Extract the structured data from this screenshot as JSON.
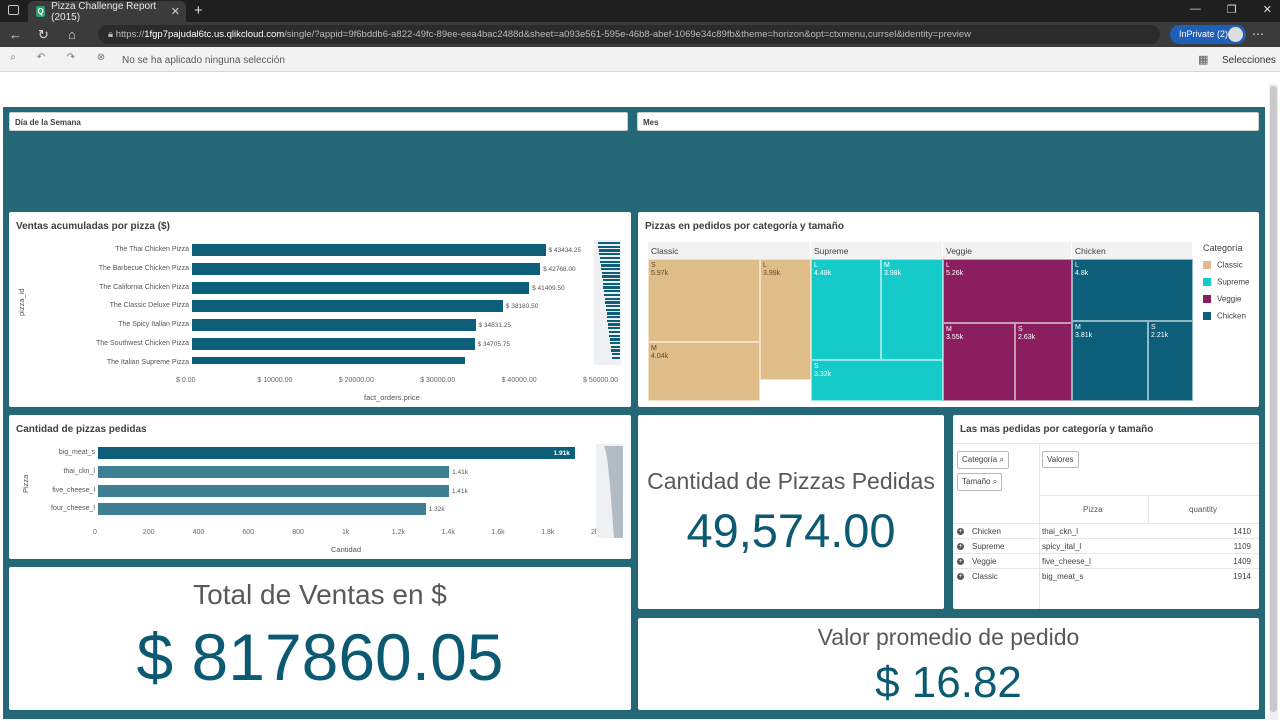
{
  "browser": {
    "tab_title": "Pizza Challenge Report (2015)",
    "url_prefix": "https://",
    "url_host": "1fgp7pajudal6tc.us.qlikcloud.com",
    "url_path": "/single/?appid=9f6bddb6-a822-49fc-89ee-eea4bac2488d&sheet=a093e561-595e-46b8-abef-1069e34c89fb&theme=horizon&opt=ctxmenu,currsel&identity=preview",
    "inprivate_label": "InPrivate (2)"
  },
  "toolbar": {
    "no_selection": "No se ha aplicado ninguna selección",
    "selections_label": "Selecciones"
  },
  "filters": {
    "day_of_week": "Día de la Semana",
    "month": "Mes"
  },
  "sales_chart": {
    "title": "Ventas acumuladas por pizza ($)",
    "xlabel": "fact_orders.price",
    "ylabel": "pizza_id"
  },
  "treemap": {
    "title": "Pizzas en pedidos por categoría y tamaño",
    "legend_title": "Categoría",
    "legend": [
      {
        "label": "Classic",
        "color": "#dfbd88"
      },
      {
        "label": "Supreme",
        "color": "#14cbc9"
      },
      {
        "label": "Veggie",
        "color": "#8b1e5e"
      },
      {
        "label": "Chicken",
        "color": "#0d5f79"
      }
    ],
    "groups": [
      {
        "name": "Classic",
        "cells": [
          {
            "size": "S",
            "value": "5.97k"
          },
          {
            "size": "L",
            "value": "3.99k"
          },
          {
            "size": "M",
            "value": "4.04k"
          }
        ]
      },
      {
        "name": "Supreme",
        "cells": [
          {
            "size": "L",
            "value": "4.48k"
          },
          {
            "size": "M",
            "value": "3.98k"
          },
          {
            "size": "S",
            "value": "3.32k"
          }
        ]
      },
      {
        "name": "Veggie",
        "cells": [
          {
            "size": "L",
            "value": "5.26k"
          },
          {
            "size": "M",
            "value": "3.55k"
          },
          {
            "size": "S",
            "value": "2.63k"
          }
        ]
      },
      {
        "name": "Chicken",
        "cells": [
          {
            "size": "L",
            "value": "4.8k"
          },
          {
            "size": "M",
            "value": "3.81k"
          },
          {
            "size": "S",
            "value": "2.21k"
          }
        ]
      }
    ]
  },
  "qty_chart": {
    "title": "Cantidad de pizzas pedidas",
    "xlabel": "Cantidad",
    "ylabel": "Pizza"
  },
  "kpi_qty": {
    "label": "Cantidad de Pizzas Pedidas",
    "value": "49,574.00"
  },
  "kpi_total": {
    "label": "Total de Ventas en $",
    "value": "$ 817860.05"
  },
  "kpi_avg": {
    "label": "Valor promedio de pedido",
    "value": "$ 16.82"
  },
  "top_table": {
    "title": "Las mas pedidas por categoría y tamaño",
    "chip_category": "Categoría",
    "chip_size": "Tamaño",
    "chip_values": "Valores",
    "col_pizza": "Pizza",
    "col_quantity": "quantity",
    "rows": [
      {
        "category": "Chicken",
        "pizza": "thai_ckn_l",
        "quantity": "1410"
      },
      {
        "category": "Supreme",
        "pizza": "spicy_ital_l",
        "quantity": "1109"
      },
      {
        "category": "Veggie",
        "pizza": "five_cheese_l",
        "quantity": "1409"
      },
      {
        "category": "Classic",
        "pizza": "big_meat_s",
        "quantity": "1914"
      }
    ]
  },
  "chart_data": [
    {
      "type": "bar",
      "orientation": "horizontal",
      "title": "Ventas acumuladas por pizza ($)",
      "xlabel": "fact_orders.price",
      "ylabel": "pizza_id",
      "xlim": [
        0,
        50000
      ],
      "x_ticks": [
        "$ 0.00",
        "$ 10000.00",
        "$ 20000.00",
        "$ 30000.00",
        "$ 40000.00",
        "$ 50000.00"
      ],
      "categories": [
        "The Thai Chicken Pizza",
        "The Barbecue Chicken Pizza",
        "The California Chicken Pizza",
        "The Classic Deluxe Pizza",
        "The Spicy Italian Pizza",
        "The Southwest Chicken Pizza",
        "The Italian Supreme Pizza"
      ],
      "values": [
        43434.25,
        42768.0,
        41409.5,
        38180.5,
        34831.25,
        34705.75,
        33476.75
      ],
      "labels": [
        "$ 43434.25",
        "$ 42768.00",
        "$ 41409.50",
        "$ 38180.50",
        "$ 34831.25",
        "$ 34705.75",
        ""
      ]
    },
    {
      "type": "bar",
      "orientation": "horizontal",
      "title": "Cantidad de pizzas pedidas",
      "xlabel": "Cantidad",
      "ylabel": "Pizza",
      "xlim": [
        0,
        2000
      ],
      "x_ticks": [
        "0",
        "200",
        "400",
        "600",
        "800",
        "1k",
        "1.2k",
        "1.4k",
        "1.6k",
        "1.8k",
        "2k"
      ],
      "categories": [
        "big_meat_s",
        "thai_ckn_l",
        "five_cheese_l",
        "four_cheese_l"
      ],
      "values": [
        1914,
        1410,
        1409,
        1316
      ],
      "labels": [
        "1.91k",
        "1.41k",
        "1.41k",
        "1.32k"
      ]
    },
    {
      "type": "treemap",
      "title": "Pizzas en pedidos por categoría y tamaño",
      "legend_title": "Categoría",
      "categories": [
        "Classic",
        "Supreme",
        "Veggie",
        "Chicken"
      ]
    }
  ]
}
